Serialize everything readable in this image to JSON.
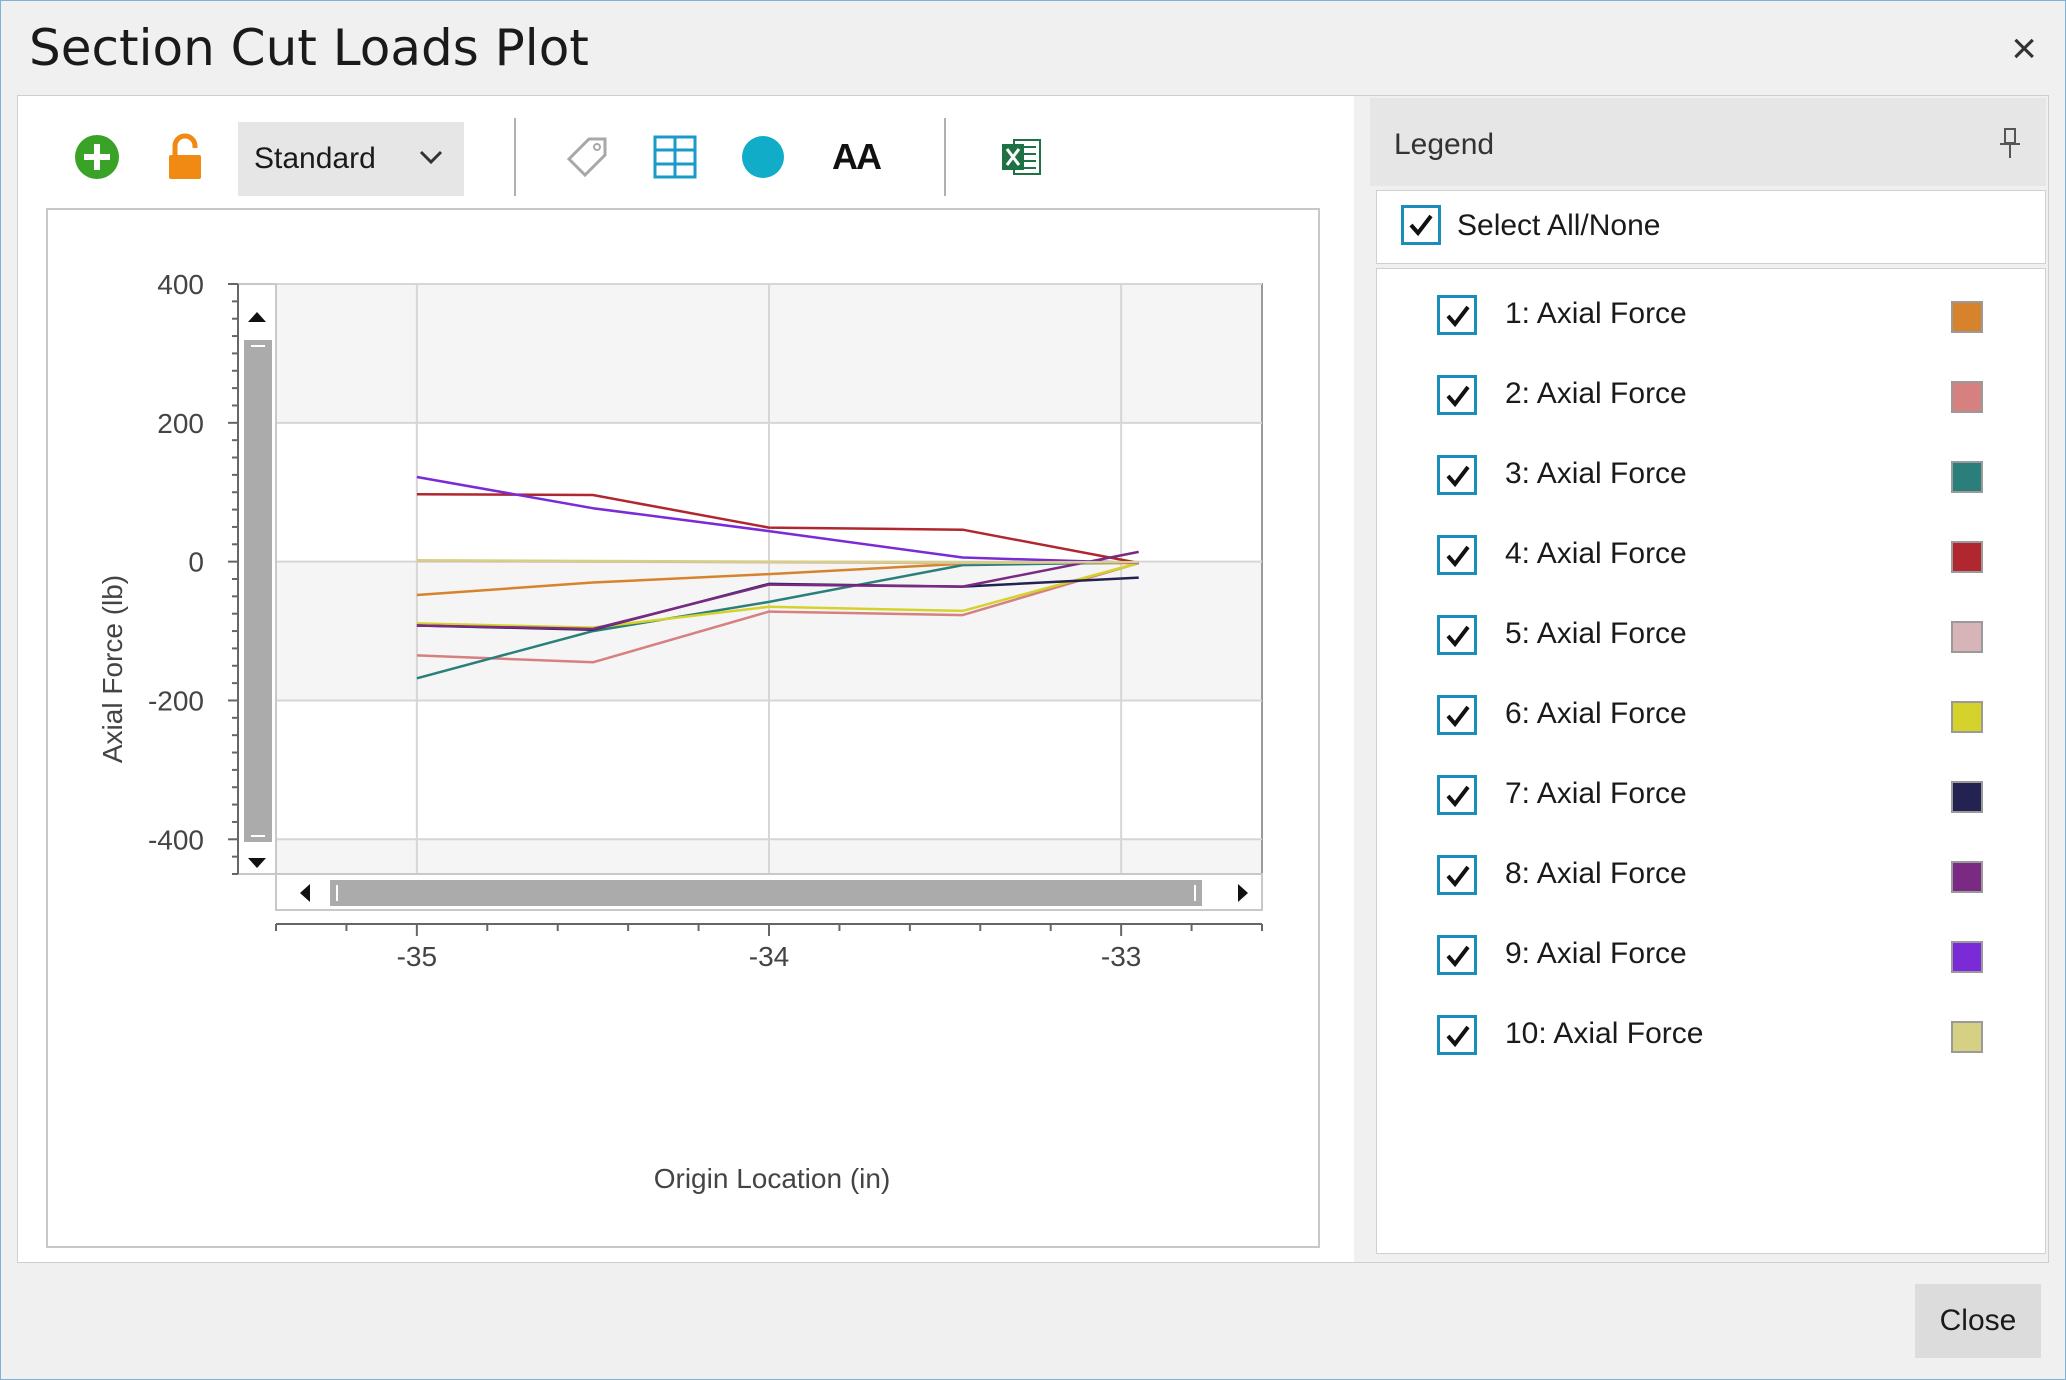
{
  "window": {
    "title": "Section Cut Loads Plot",
    "close_label": "×"
  },
  "toolbar": {
    "add_icon": "plus-circle-icon",
    "lock_icon": "unlock-icon",
    "style_select": "Standard",
    "tag_icon": "tag-icon",
    "grid_icon": "grid-icon",
    "marker_icon": "circle-marker-icon",
    "font_label": "AA",
    "excel_icon": "excel-export-icon"
  },
  "legend": {
    "title": "Legend",
    "select_all_label": "Select All/None",
    "items": [
      {
        "label": "1: Axial Force",
        "color": "#d7832b",
        "checked": true
      },
      {
        "label": "2: Axial Force",
        "color": "#d68080",
        "checked": true
      },
      {
        "label": "3: Axial Force",
        "color": "#2a7f7a",
        "checked": true
      },
      {
        "label": "4: Axial Force",
        "color": "#b0272f",
        "checked": true
      },
      {
        "label": "5: Axial Force",
        "color": "#d6b4b8",
        "checked": true
      },
      {
        "label": "6: Axial Force",
        "color": "#d6d22c",
        "checked": true
      },
      {
        "label": "7: Axial Force",
        "color": "#232250",
        "checked": true
      },
      {
        "label": "8: Axial Force",
        "color": "#7a2a82",
        "checked": true
      },
      {
        "label": "9: Axial Force",
        "color": "#7a2ad6",
        "checked": true
      },
      {
        "label": "10: Axial Force",
        "color": "#d6d084",
        "checked": true
      }
    ]
  },
  "buttons": {
    "close": "Close"
  },
  "chart_data": {
    "type": "line",
    "xlabel": "Origin Location (in)",
    "ylabel": "Axial Force (lb)",
    "xlim": [
      -35.4,
      -32.6
    ],
    "ylim": [
      -450,
      400
    ],
    "xticks": [
      -35,
      -34,
      -33
    ],
    "xtick_labels": [
      "-35",
      "-34",
      "-33"
    ],
    "yticks": [
      400,
      200,
      0,
      -200,
      -400
    ],
    "ytick_labels": [
      "400",
      "200",
      "0",
      "-200",
      "-400"
    ],
    "grid": true,
    "series": [
      {
        "name": "1: Axial Force",
        "color": "#d7832b",
        "points": [
          [
            -35,
            -48
          ],
          [
            -34.5,
            -30
          ],
          [
            -34,
            -18
          ],
          [
            -33.45,
            -3
          ],
          [
            -32.95,
            -2
          ]
        ]
      },
      {
        "name": "2: Axial Force",
        "color": "#d68080",
        "points": [
          [
            -35,
            -135
          ],
          [
            -34.5,
            -145
          ],
          [
            -34,
            -72
          ],
          [
            -33.45,
            -77
          ],
          [
            -32.95,
            -2
          ]
        ]
      },
      {
        "name": "3: Axial Force",
        "color": "#2a7f7a",
        "points": [
          [
            -35,
            -168
          ],
          [
            -34.5,
            -100
          ],
          [
            -34,
            -58
          ],
          [
            -33.45,
            -5
          ],
          [
            -32.95,
            -1
          ]
        ]
      },
      {
        "name": "4: Axial Force",
        "color": "#b0272f",
        "points": [
          [
            -35,
            97
          ],
          [
            -34.5,
            96
          ],
          [
            -34,
            49
          ],
          [
            -33.45,
            46
          ],
          [
            -32.95,
            -2
          ]
        ]
      },
      {
        "name": "5: Axial Force",
        "color": "#d6b4b8",
        "points": [
          [
            -35,
            1
          ],
          [
            -34.5,
            0
          ],
          [
            -34,
            -1
          ],
          [
            -33.45,
            -2
          ],
          [
            -32.95,
            -1
          ]
        ]
      },
      {
        "name": "6: Axial Force",
        "color": "#d6d22c",
        "points": [
          [
            -35,
            -89
          ],
          [
            -34.5,
            -95
          ],
          [
            -34,
            -65
          ],
          [
            -33.45,
            -71
          ],
          [
            -32.95,
            -2
          ]
        ]
      },
      {
        "name": "7: Axial Force",
        "color": "#232250",
        "points": [
          [
            -35,
            -92
          ],
          [
            -34.5,
            -98
          ],
          [
            -34,
            -32
          ],
          [
            -33.45,
            -36
          ],
          [
            -32.95,
            -23
          ]
        ]
      },
      {
        "name": "8: Axial Force",
        "color": "#7a2a82",
        "points": [
          [
            -35,
            -92
          ],
          [
            -34.5,
            -97
          ],
          [
            -34,
            -33
          ],
          [
            -33.45,
            -36
          ],
          [
            -32.95,
            14
          ]
        ]
      },
      {
        "name": "9: Axial Force",
        "color": "#7a2ad6",
        "points": [
          [
            -35,
            122
          ],
          [
            -34.5,
            77
          ],
          [
            -34,
            44
          ],
          [
            -33.45,
            6
          ],
          [
            -32.95,
            -2
          ]
        ]
      },
      {
        "name": "10: Axial Force",
        "color": "#d6d084",
        "points": [
          [
            -35,
            2
          ],
          [
            -34.5,
            1
          ],
          [
            -34,
            0
          ],
          [
            -33.45,
            -1
          ],
          [
            -32.95,
            -1
          ]
        ]
      }
    ]
  }
}
